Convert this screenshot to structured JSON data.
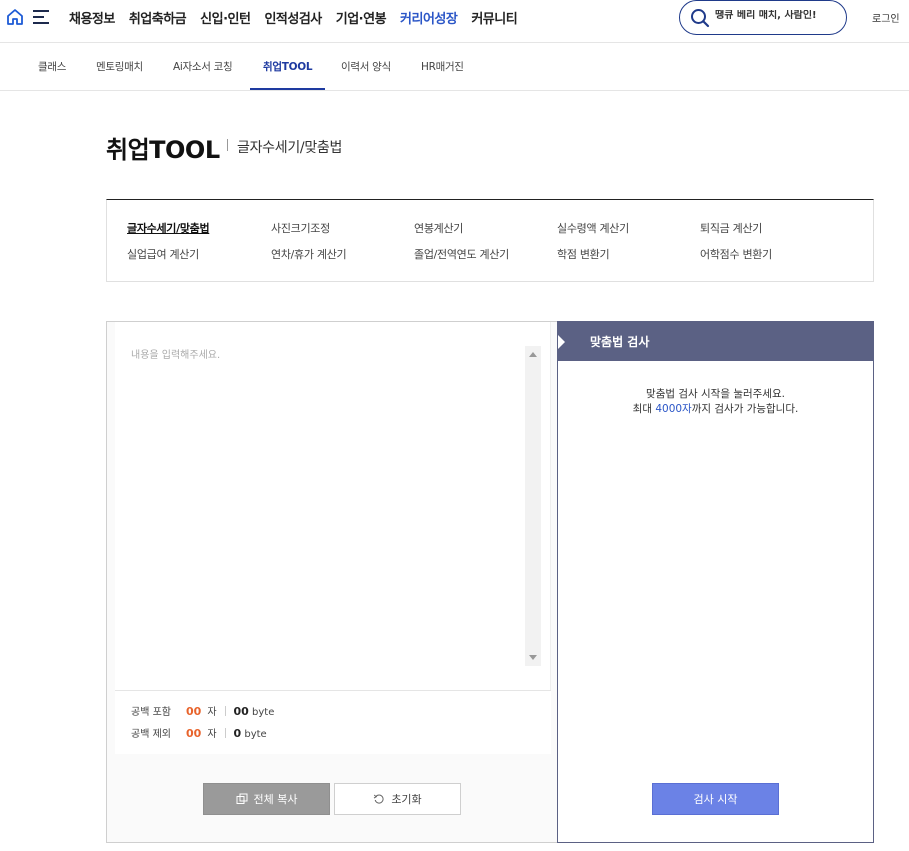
{
  "gnb": {
    "nav": [
      "채용정보",
      "취업축하금",
      "신입·인턴",
      "인적성검사",
      "기업·연봉",
      "커리어성장",
      "커뮤니티"
    ],
    "active_nav": "커리어성장",
    "search_placeholder": "땡큐 베리 매치, 사람인!",
    "login": "로그인",
    "colors": {
      "brand": "#1f3a8a",
      "active": "#2b56c7"
    }
  },
  "subnav": {
    "items": [
      "클래스",
      "멘토링매치",
      "Ai자소서 코칭",
      "취업TOOL",
      "이력서 양식",
      "HR매거진"
    ],
    "active": "취업TOOL"
  },
  "page": {
    "title": "취업TOOL",
    "subtitle": "글자수세기/맞춤법"
  },
  "tools": [
    [
      "글자수세기/맞춤법",
      "사진크기조정",
      "연봉계산기",
      "실수령액 계산기",
      "퇴직금 계산기"
    ],
    [
      "실업급여 계산기",
      "연차/휴가 계산기",
      "졸업/전역연도 계산기",
      "학점 변환기",
      "어학점수 변환기"
    ]
  ],
  "editor": {
    "placeholder": "내용을 입력해주세요.",
    "with_space_label": "공백 포함",
    "without_space_label": "공백 제외",
    "with_space_chars": "00",
    "without_space_chars": "00",
    "char_unit": "자",
    "with_space_bytes": "00",
    "without_space_bytes": "0",
    "byte_unit": "byte",
    "copy_all": "전체 복사",
    "reset": "초기화"
  },
  "panel": {
    "title": "맞춤법 검사",
    "msg_line1": "맞춤법 검사 시작을 눌러주세요.",
    "msg_pre": "최대 ",
    "msg_highlight": "4000자",
    "msg_post": "까지 검사가 가능합니다.",
    "start": "검사 시작",
    "colors": {
      "header": "#5b6184",
      "button": "#6b82e6"
    }
  }
}
